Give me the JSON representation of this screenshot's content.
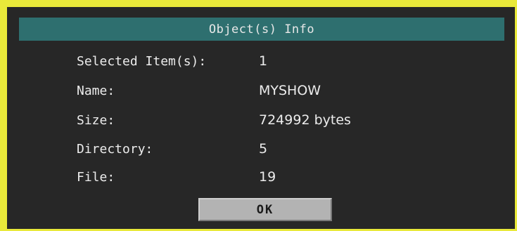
{
  "dialog": {
    "title": "Object(s) Info",
    "fields": [
      {
        "label": "Selected Item(s):",
        "value": "1"
      },
      {
        "label": "Name:",
        "value": "MYSHOW"
      },
      {
        "label": "Size:",
        "value": "724992 bytes"
      },
      {
        "label": "Directory:",
        "value": "5"
      },
      {
        "label": "File:",
        "value": "19"
      }
    ],
    "ok_label": "OK"
  },
  "colors": {
    "frame": "#e9e93a",
    "background": "#272727",
    "title_bar": "#2e6f6f",
    "text": "#ececec",
    "button": "#b3b3b3"
  }
}
